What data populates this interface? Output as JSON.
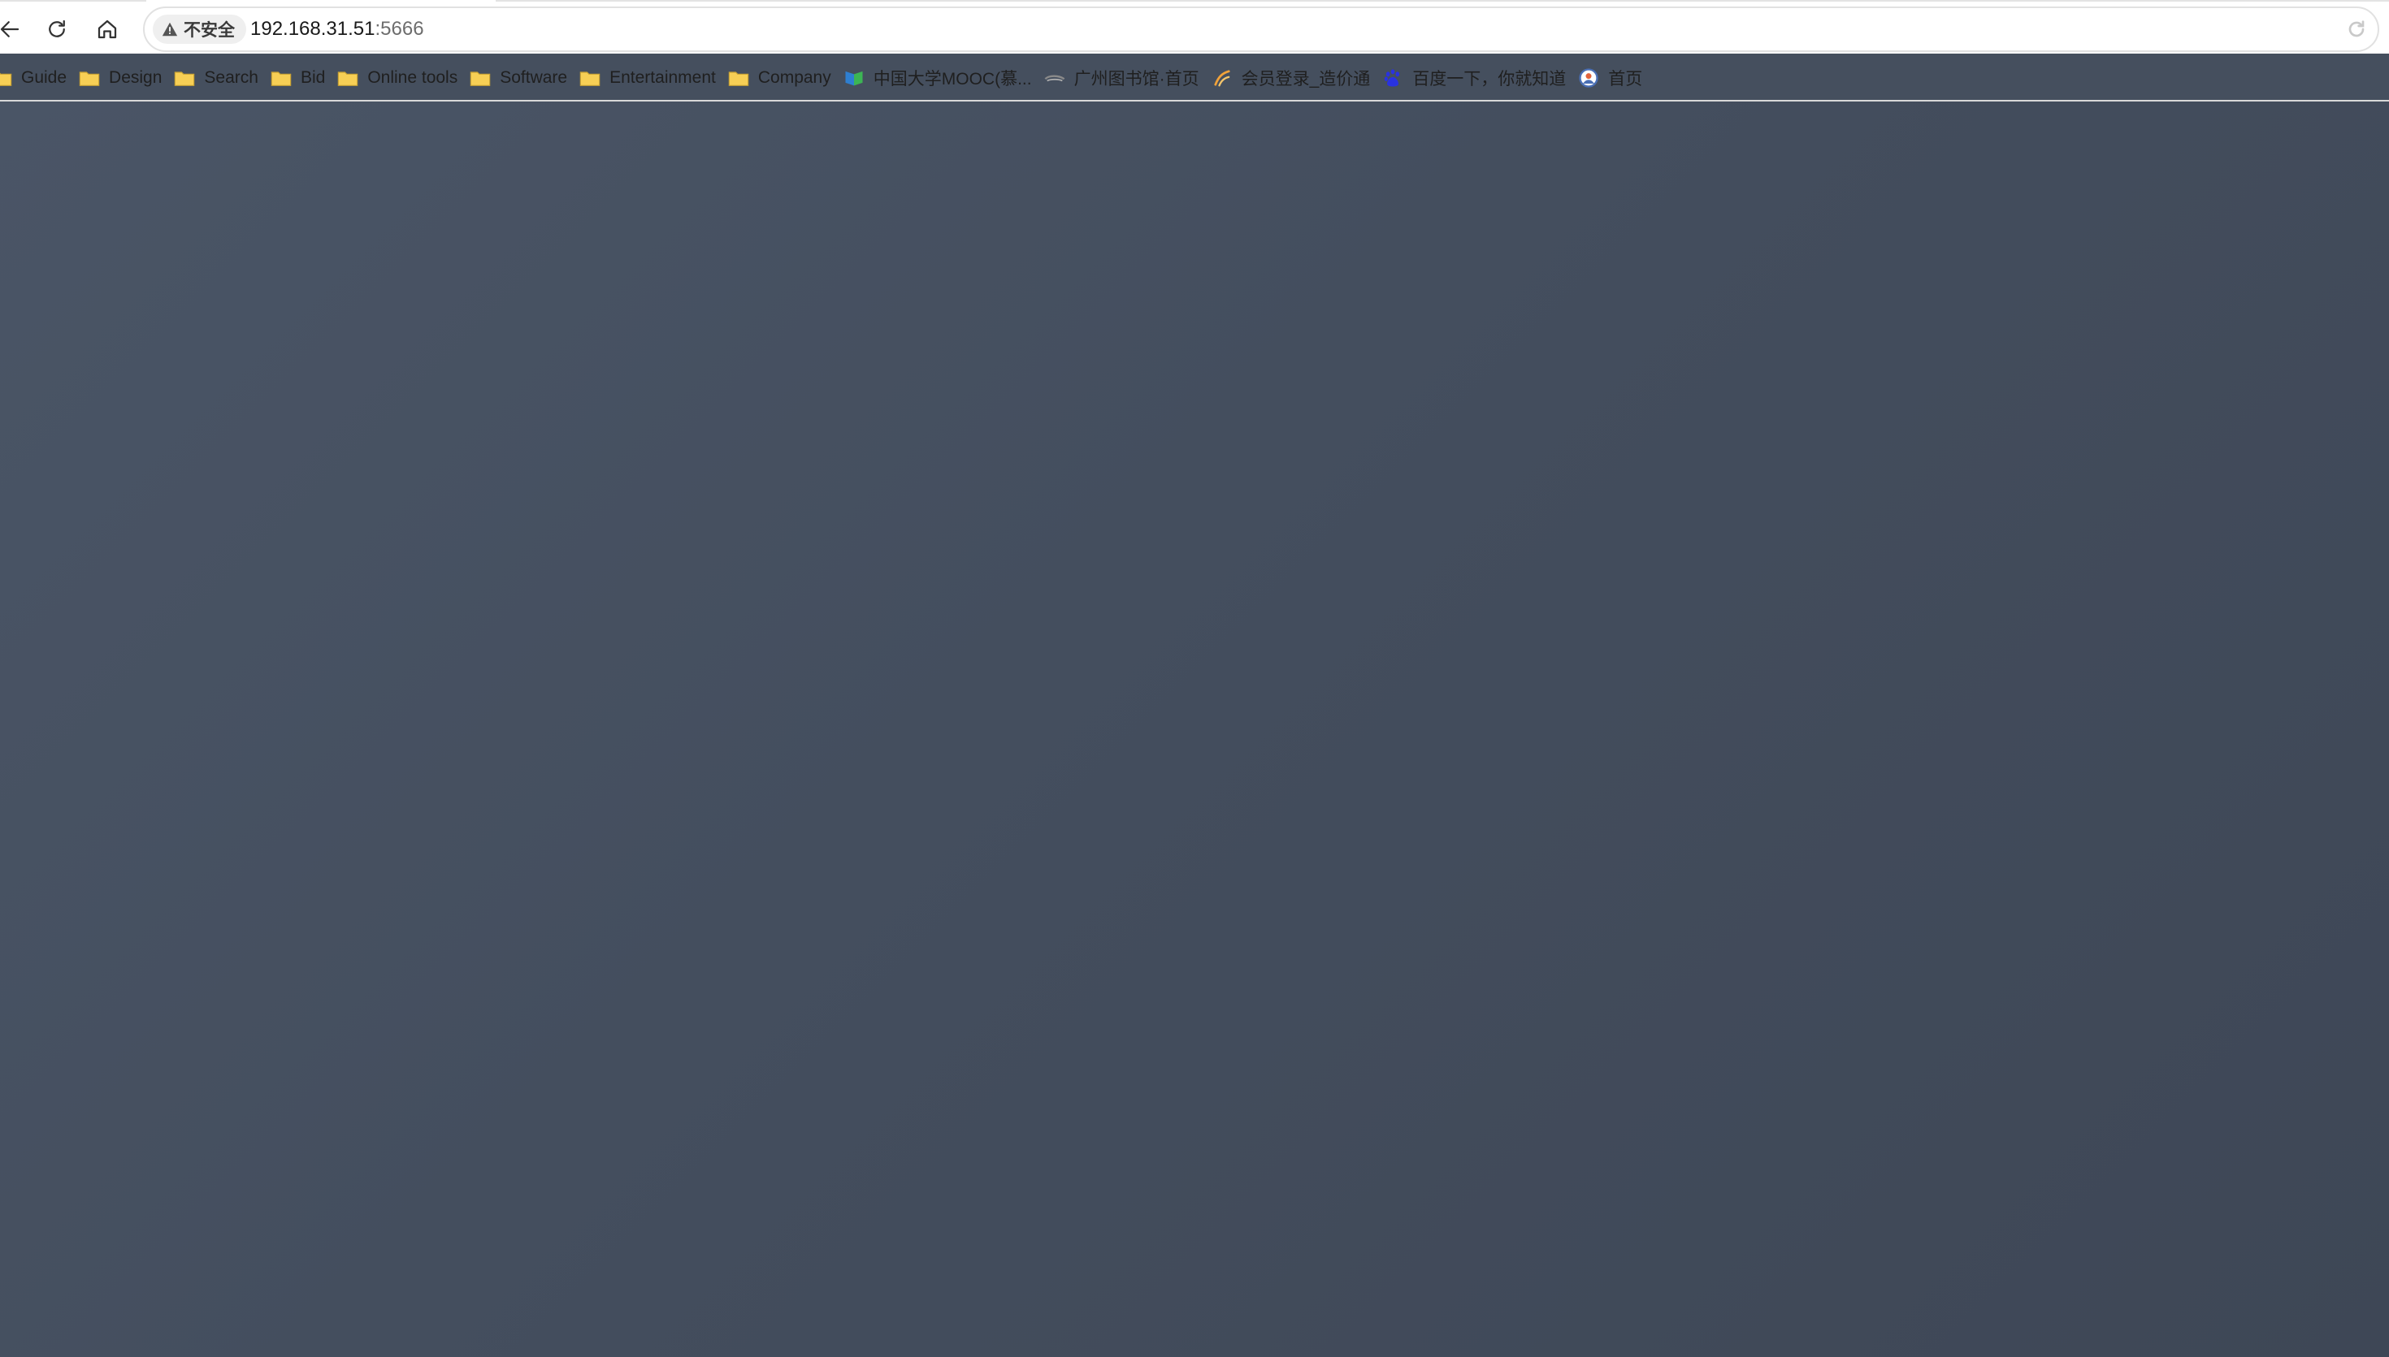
{
  "browser": {
    "address_bar": {
      "security_label": "不安全",
      "url_host": "192.168.31.51",
      "url_port": ":5666"
    },
    "bookmarks": [
      {
        "label": "Guide",
        "icon": "folder-icon"
      },
      {
        "label": "Design",
        "icon": "folder-icon"
      },
      {
        "label": "Search",
        "icon": "folder-icon"
      },
      {
        "label": "Bid",
        "icon": "folder-icon"
      },
      {
        "label": "Online tools",
        "icon": "folder-icon"
      },
      {
        "label": "Software",
        "icon": "folder-icon"
      },
      {
        "label": "Entertainment",
        "icon": "folder-icon"
      },
      {
        "label": "Company",
        "icon": "folder-icon"
      },
      {
        "label": "中国大学MOOC(慕...",
        "icon": "mooc-icon"
      },
      {
        "label": "广州图书馆·首页",
        "icon": "library-icon"
      },
      {
        "label": "会员登录_造价通",
        "icon": "zaojiatong-icon"
      },
      {
        "label": "百度一下，你就知道",
        "icon": "baidu-paw-icon"
      },
      {
        "label": "首页",
        "icon": "globe-icon"
      }
    ],
    "colors": {
      "page_background": "#454f5e",
      "folder_fill": "#f7cf55",
      "toolbar_background": "#ffffff"
    }
  }
}
